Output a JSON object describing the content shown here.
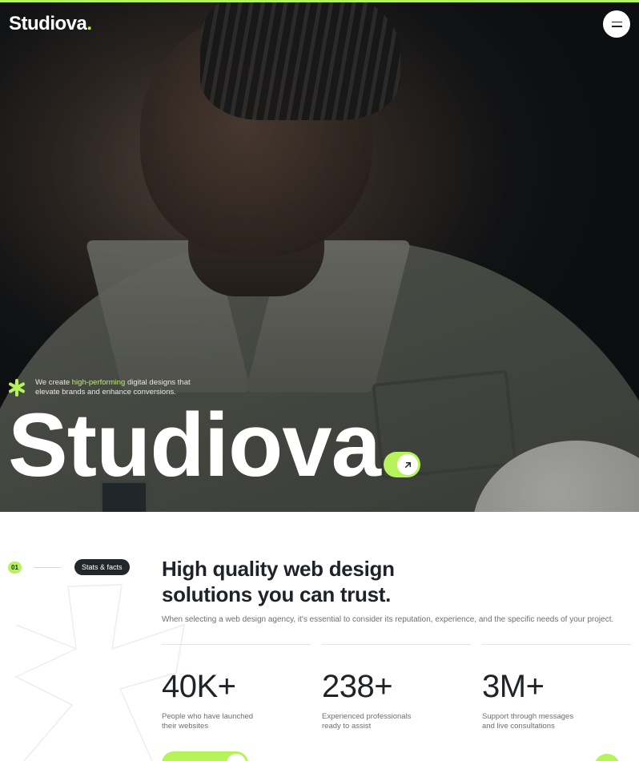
{
  "brand": {
    "name": "Studiova",
    "dot": ".",
    "accent": "#b6f25a",
    "dark": "#22272b"
  },
  "nav": {
    "menu_icon": "hamburger-icon"
  },
  "hero": {
    "tagline_pre": "We create ",
    "tagline_highlight": "high-performing",
    "tagline_post": " digital designs that elevate brands and enhance conversions.",
    "title": "Studiova",
    "cta_icon": "arrow-up-right-icon",
    "asterisk_icon": "asterisk-icon"
  },
  "stats_section": {
    "step": "01",
    "badge": "Stats & facts",
    "title": "High quality web design solutions you can trust.",
    "description": "When selecting a web design agency, it's essential to consider its reputation, experience, and the specific needs of your project.",
    "items": [
      {
        "value": "40K+",
        "label": "People who have launched their websites"
      },
      {
        "value": "238+",
        "label": "Experienced professionals ready to assist"
      },
      {
        "value": "3M+",
        "label": "Support through messages and live consultations"
      }
    ]
  }
}
